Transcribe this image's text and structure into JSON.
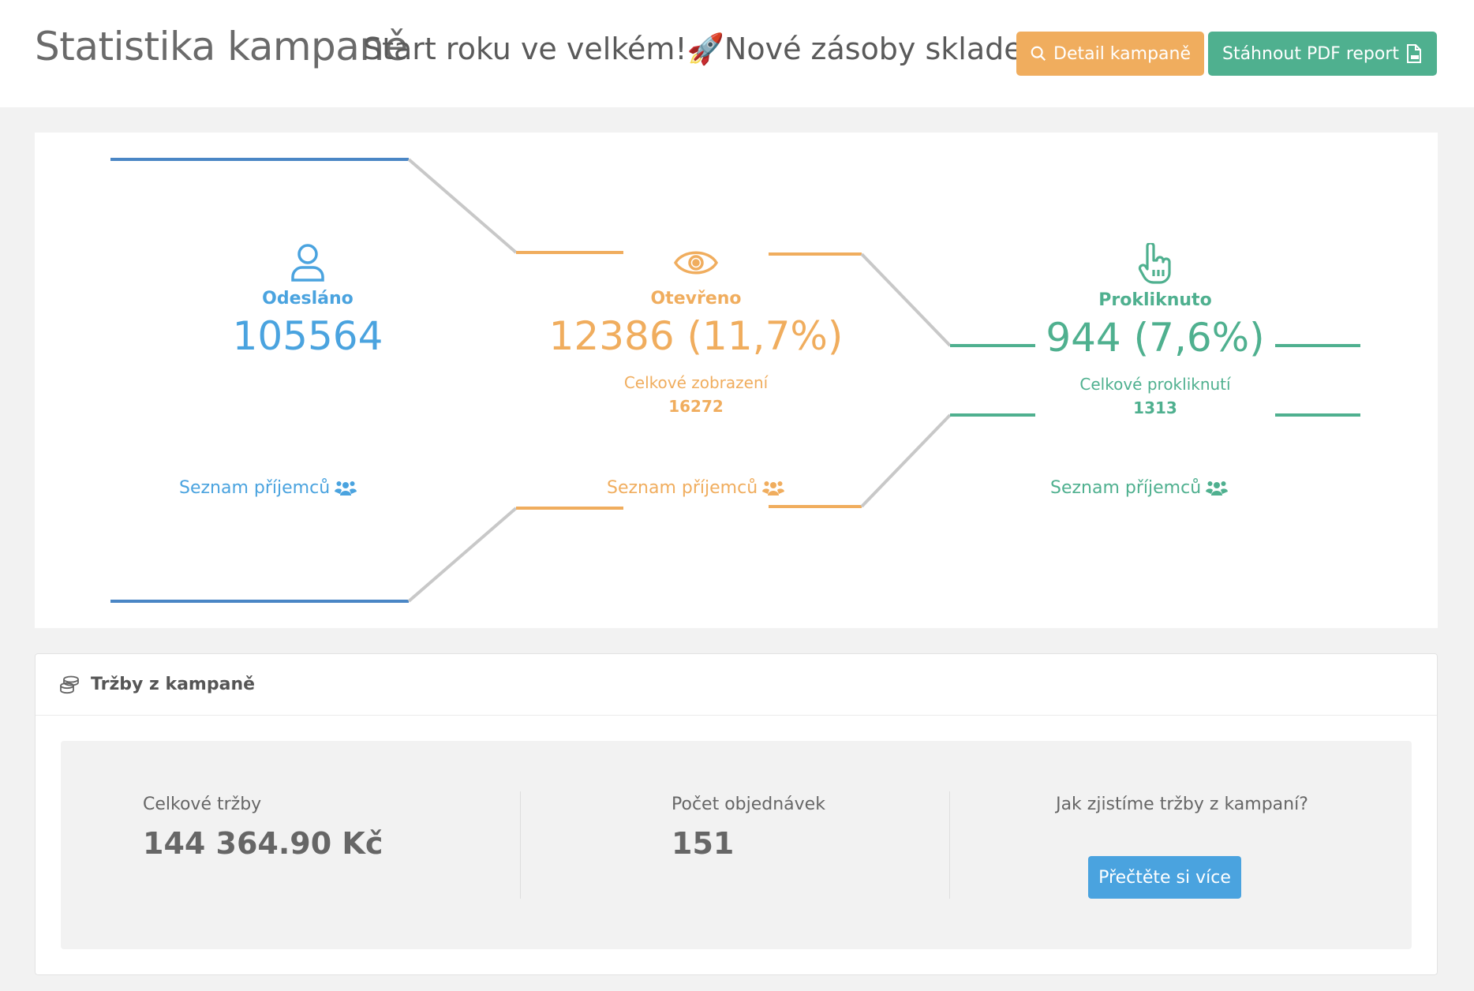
{
  "header": {
    "title": "Statistika kampaně",
    "campaign_name": "Start roku ve velkém!🚀Nové zásoby skladem",
    "detail_button": "Detail kampaně",
    "pdf_button": "Stáhnout PDF report"
  },
  "funnel": {
    "sent": {
      "icon": "user-icon",
      "label": "Odesláno",
      "value": "105564",
      "link": "Seznam příjemců"
    },
    "opened": {
      "icon": "eye-icon",
      "label": "Otevřeno",
      "value": "12386 (11,7%)",
      "total_label": "Celkové zobrazení",
      "total_value": "16272",
      "link": "Seznam příjemců"
    },
    "clicked": {
      "icon": "hand-pointer-icon",
      "label": "Prokliknuto",
      "value": "944 (7,6%)",
      "total_label": "Celkové prokliknutí",
      "total_value": "1313",
      "link": "Seznam příjemců"
    },
    "colors": {
      "sent": "#4a86c5",
      "opened": "#f0ad5e",
      "clicked": "#4fb08f",
      "connector": "#c8c8c8"
    }
  },
  "revenue": {
    "title": "Tržby z kampaně",
    "total_label": "Celkové tržby",
    "total_value": "144 364.90 Kč",
    "orders_label": "Počet objednávek",
    "orders_value": "151",
    "how_label": "Jak zjistíme tržby z kampaní?",
    "read_more": "Přečtěte si více"
  }
}
